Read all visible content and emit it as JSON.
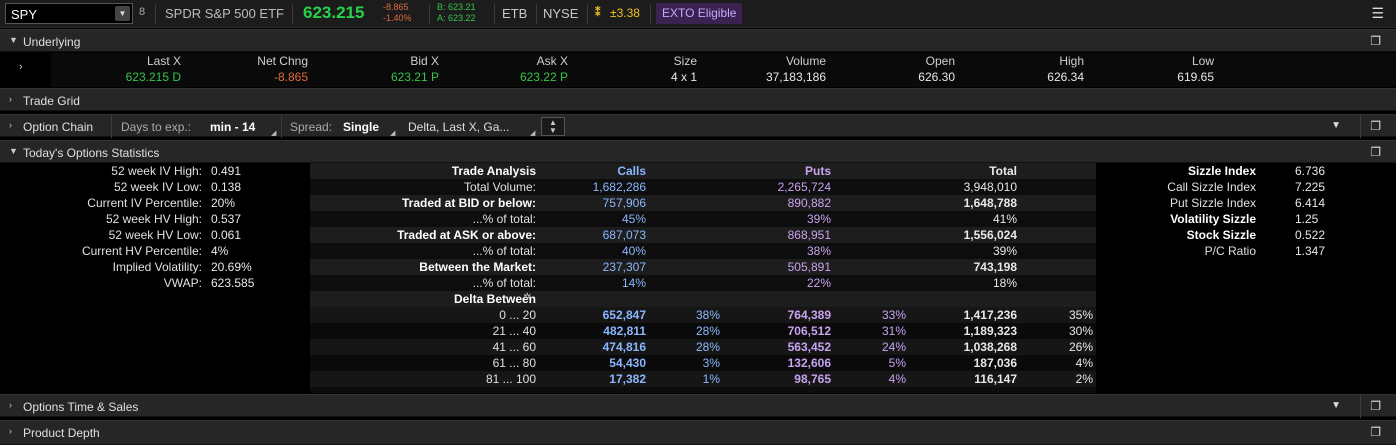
{
  "topbar": {
    "symbol": "SPY",
    "description": "SPDR S&P 500 ETF",
    "last": "623.215",
    "net_change": "-8.865",
    "pct_change": "-1.40%",
    "bid": "B: 623.21",
    "ask": "A: 623.22",
    "etb": "ETB",
    "exchange": "NYSE",
    "expected_move": "±3.38",
    "exto": "EXTO Eligible"
  },
  "sections": {
    "underlying": "Underlying",
    "trade_grid": "Trade Grid",
    "option_chain": "Option Chain",
    "todays_stats": "Today's Options Statistics",
    "time_sales": "Options Time & Sales",
    "product_depth": "Product Depth"
  },
  "option_chain": {
    "days_label": "Days to exp.:",
    "days_value": "min - 14",
    "spread_label": "Spread:",
    "spread_value": "Single",
    "columns_value": "Delta, Last X, Ga..."
  },
  "underlying": {
    "columns": [
      {
        "header": "Last X",
        "value": "623.215 D",
        "color": "green"
      },
      {
        "header": "Net Chng",
        "value": "-8.865",
        "color": "red"
      },
      {
        "header": "Bid X",
        "value": "623.21 P",
        "color": "green"
      },
      {
        "header": "Ask X",
        "value": "623.22 P",
        "color": "green"
      },
      {
        "header": "Size",
        "value": "4 x 1",
        "color": "white"
      },
      {
        "header": "Volume",
        "value": "37,183,186",
        "color": "white"
      },
      {
        "header": "Open",
        "value": "626.30",
        "color": "white"
      },
      {
        "header": "High",
        "value": "626.34",
        "color": "white"
      },
      {
        "header": "Low",
        "value": "619.65",
        "color": "white"
      }
    ]
  },
  "left_stats": [
    {
      "label": "52 week IV High:",
      "value": "0.491"
    },
    {
      "label": "52 week IV Low:",
      "value": "0.138"
    },
    {
      "label": "Current IV Percentile:",
      "value": "20%"
    },
    {
      "label": "52 week HV High:",
      "value": "0.537"
    },
    {
      "label": "52 week HV Low:",
      "value": "0.061"
    },
    {
      "label": "Current HV Percentile:",
      "value": "4%"
    },
    {
      "label": "Implied Volatility:",
      "value": "20.69%"
    },
    {
      "label": "VWAP:",
      "value": "623.585"
    }
  ],
  "trade_analysis": {
    "header": {
      "label": "Trade Analysis",
      "calls": "Calls",
      "puts": "Puts",
      "total": "Total"
    },
    "rows": [
      {
        "label": "Total Volume:",
        "bold": false,
        "calls": "1,682,286",
        "puts": "2,265,724",
        "total": "3,948,010",
        "vbold": false
      },
      {
        "label": "Traded at BID or below:",
        "bold": true,
        "calls": "757,906",
        "puts": "890,882",
        "total": "1,648,788",
        "vbold": true
      },
      {
        "label": "...% of total:",
        "bold": false,
        "calls": "45%",
        "puts": "39%",
        "total": "41%",
        "vbold": false
      },
      {
        "label": "Traded at ASK or above:",
        "bold": true,
        "calls": "687,073",
        "puts": "868,951",
        "total": "1,556,024",
        "vbold": true
      },
      {
        "label": "...% of total:",
        "bold": false,
        "calls": "40%",
        "puts": "38%",
        "total": "39%",
        "vbold": false
      },
      {
        "label": "Between the Market:",
        "bold": true,
        "calls": "237,307",
        "puts": "505,891",
        "total": "743,198",
        "vbold": true
      },
      {
        "label": "...% of total:",
        "bold": false,
        "calls": "14%",
        "puts": "22%",
        "total": "18%",
        "vbold": false
      }
    ],
    "delta_header": "Delta Between",
    "delta_rows": [
      {
        "range": "0 ... 20",
        "calls": "652,847",
        "calls_pct": "38%",
        "puts": "764,389",
        "puts_pct": "33%",
        "total": "1,417,236",
        "total_pct": "35%"
      },
      {
        "range": "21 ... 40",
        "calls": "482,811",
        "calls_pct": "28%",
        "puts": "706,512",
        "puts_pct": "31%",
        "total": "1,189,323",
        "total_pct": "30%"
      },
      {
        "range": "41 ... 60",
        "calls": "474,816",
        "calls_pct": "28%",
        "puts": "563,452",
        "puts_pct": "24%",
        "total": "1,038,268",
        "total_pct": "26%"
      },
      {
        "range": "61 ... 80",
        "calls": "54,430",
        "calls_pct": "3%",
        "puts": "132,606",
        "puts_pct": "5%",
        "total": "187,036",
        "total_pct": "4%"
      },
      {
        "range": "81 ... 100",
        "calls": "17,382",
        "calls_pct": "1%",
        "puts": "98,765",
        "puts_pct": "4%",
        "total": "116,147",
        "total_pct": "2%"
      }
    ]
  },
  "sizzle": [
    {
      "label": "Sizzle Index",
      "value": "6.736",
      "bold": true
    },
    {
      "label": "Call Sizzle Index",
      "value": "7.225",
      "bold": false
    },
    {
      "label": "Put Sizzle Index",
      "value": "6.414",
      "bold": false
    },
    {
      "label": "Volatility Sizzle",
      "value": "1.25",
      "bold": true
    },
    {
      "label": "Stock Sizzle",
      "value": "0.522",
      "bold": true
    },
    {
      "label": "P/C Ratio",
      "value": "1.347",
      "bold": false
    }
  ],
  "colors": {
    "green": "#34c44c",
    "red": "#e0693c",
    "calls": "#8bb7ff",
    "puts": "#c8a3f0",
    "exto_bg": "#3a2350"
  }
}
